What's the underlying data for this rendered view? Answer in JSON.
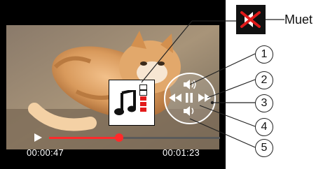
{
  "mute": {
    "icon": "speaker-muted-icon",
    "label": "Muet"
  },
  "playback": {
    "elapsed": "00:00:47",
    "total": "00:01:23",
    "progress_fraction": 0.41,
    "volume_level": 3,
    "volume_max": 5
  },
  "controls": {
    "volume_up": "volume-up-icon",
    "rewind": "rewind-icon",
    "pause": "pause-icon",
    "fast_forward": "fast-forward-icon",
    "volume_down": "volume-down-icon"
  },
  "callouts": [
    "1",
    "2",
    "3",
    "4",
    "5"
  ],
  "colors": {
    "progress": "#ff2a2a",
    "volume_active": "#e21b1b",
    "volume_inactive": "#ffffff"
  }
}
